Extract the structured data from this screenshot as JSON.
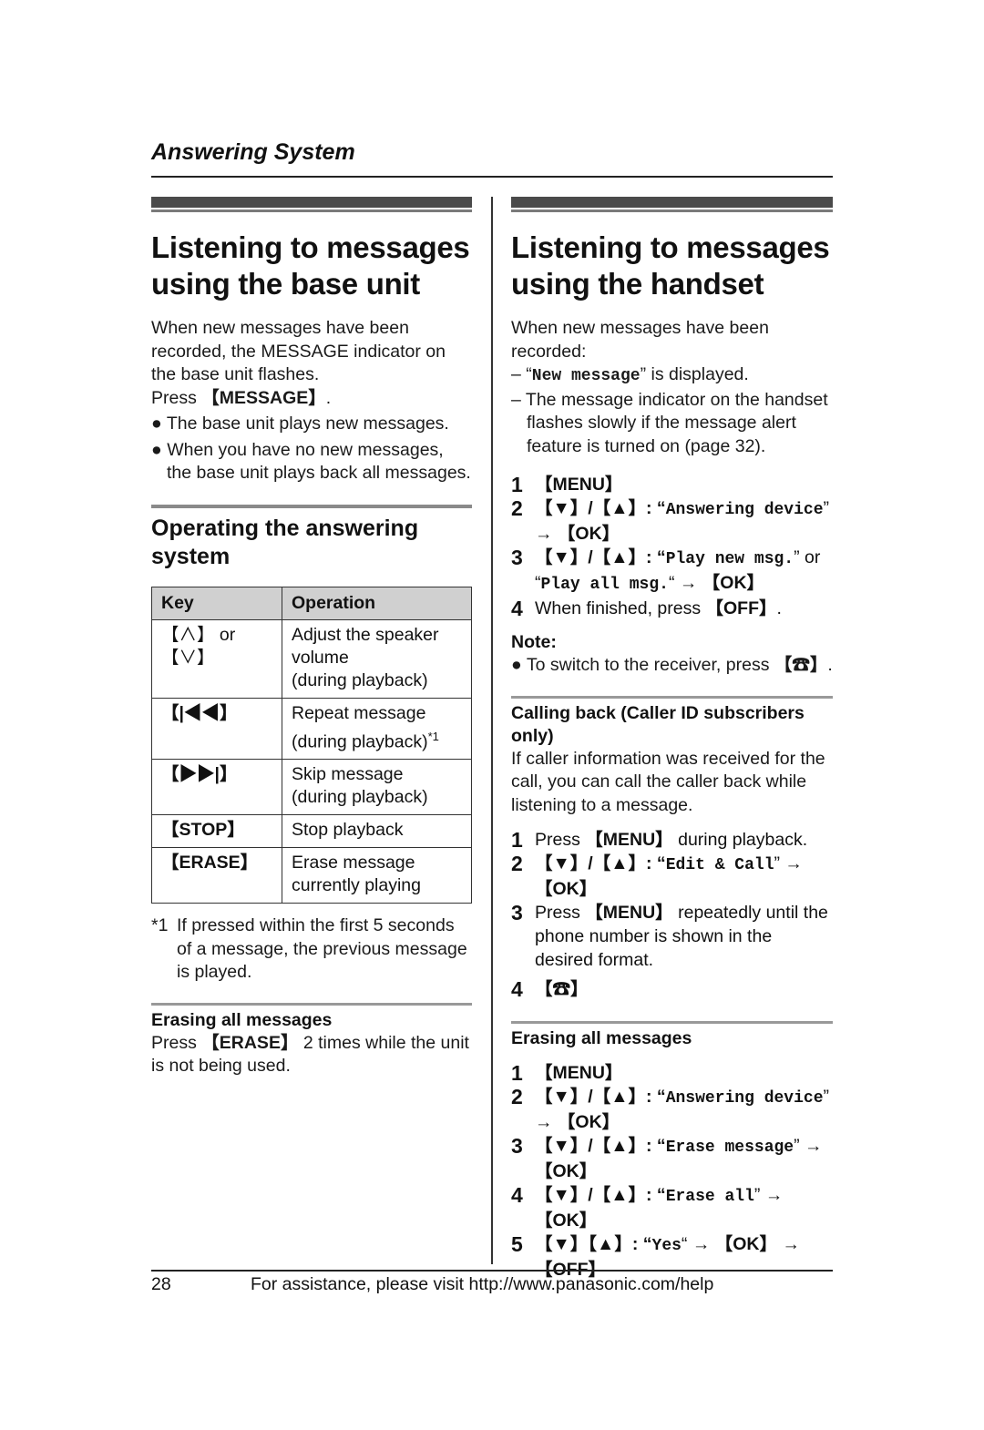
{
  "header": {
    "section": "Answering System"
  },
  "left": {
    "title": "Listening to messages using the base unit",
    "intro": "When new messages have been recorded, the MESSAGE indicator on the base unit flashes.",
    "press_prefix": "Press ",
    "press_key": "【MESSAGE】",
    "press_suffix": ".",
    "bullets": [
      "The base unit plays new messages.",
      "When you have no new messages, the base unit plays back all messages."
    ],
    "operating": {
      "title": "Operating the answering system",
      "table": {
        "headers": [
          "Key",
          "Operation"
        ],
        "rows": [
          {
            "key": "【∧】 or 【∨】",
            "op": "Adjust the speaker volume",
            "op2": "(during playback)",
            "icon": "volume-up-down-icon"
          },
          {
            "key": "【|◀◀】",
            "op": "Repeat message",
            "op2": "(during playback)",
            "sup": "*1",
            "icon": "repeat-icon"
          },
          {
            "key": "【▶▶|】",
            "op": "Skip message",
            "op2": "(during playback)",
            "icon": "skip-icon"
          },
          {
            "key": "【STOP】",
            "op": "Stop playback",
            "op2": ""
          },
          {
            "key": "【ERASE】",
            "op": "Erase message",
            "op2": "currently playing"
          }
        ]
      },
      "footnote_mark": "*1",
      "footnote": "If pressed within the first 5 seconds of a message, the previous message is played."
    },
    "erasing": {
      "title": "Erasing all messages",
      "prefix": "Press ",
      "key": "【ERASE】",
      "suffix": " 2 times while the unit is not being used."
    }
  },
  "right": {
    "title": "Listening to messages using the handset",
    "intro": "When new messages have been recorded:",
    "dash1_display": "New message",
    "dash1_suffix": "” is displayed.",
    "dash2": "The message indicator on the handset flashes slowly if the message alert feature is turned on (page 32).",
    "steps": [
      {
        "n": "1",
        "html_parts": [
          "【MENU】"
        ]
      },
      {
        "n": "2",
        "nav": "【▼】/【▲】: “",
        "display": "Answering device",
        "after": "” → ",
        "key": "【OK】"
      },
      {
        "n": "3",
        "nav": "【▼】/【▲】: “",
        "display": "Play new msg.",
        "mid": "” or “",
        "display2": "Play all msg.",
        "after": "“ → ",
        "key": "【OK】"
      },
      {
        "n": "4",
        "prefix": "When finished, press ",
        "key": "【OFF】",
        "suffix": "."
      }
    ],
    "note_title": "Note:",
    "note": "To switch to the receiver, press ",
    "note_key": "【☎】",
    "calling": {
      "title": "Calling back (Caller ID subscribers only)",
      "intro": "If caller information was received for the call, you can call the caller back while listening to a message.",
      "steps": [
        {
          "n": "1",
          "prefix": "Press ",
          "key": "【MENU】",
          "suffix": " during playback."
        },
        {
          "n": "2",
          "nav": "【▼】/【▲】: “",
          "display": "Edit & Call",
          "after": "” → ",
          "key": "【OK】"
        },
        {
          "n": "3",
          "prefix": "Press ",
          "key": "【MENU】",
          "suffix": " repeatedly until the phone number is shown in the desired format."
        },
        {
          "n": "4",
          "key": "【☎】"
        }
      ]
    },
    "erasing": {
      "title": "Erasing all messages",
      "steps": [
        {
          "n": "1",
          "key": "【MENU】"
        },
        {
          "n": "2",
          "nav": "【▼】/【▲】: “",
          "display": "Answering device",
          "after": "” → ",
          "key": "【OK】"
        },
        {
          "n": "3",
          "nav": "【▼】/【▲】: “",
          "display": "Erase message",
          "after": "” → ",
          "key": "【OK】"
        },
        {
          "n": "4",
          "nav": "【▼】/【▲】: “",
          "display": "Erase all",
          "after": "” → ",
          "key": "【OK】"
        },
        {
          "n": "5",
          "nav": "【▼】【▲】: “",
          "display": "Yes",
          "after": "“ → ",
          "key": "【OK】",
          "after2": " → ",
          "key2": "【OFF】"
        }
      ]
    }
  },
  "footer": {
    "page": "28",
    "text": "For assistance, please visit http://www.panasonic.com/help"
  }
}
